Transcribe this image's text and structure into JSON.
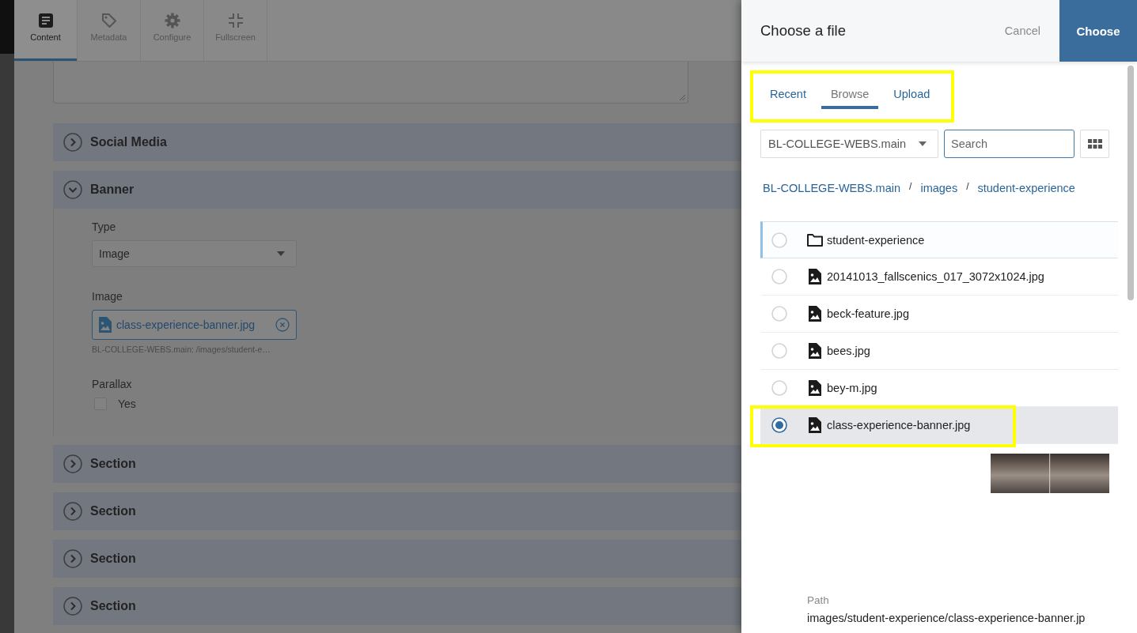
{
  "toolbar": {
    "tabs": [
      {
        "label": "Content",
        "selected": true
      },
      {
        "label": "Metadata",
        "selected": false
      },
      {
        "label": "Configure",
        "selected": false
      },
      {
        "label": "Fullscreen",
        "selected": false
      }
    ]
  },
  "sections": [
    {
      "title": "Social Media",
      "expanded": false
    },
    {
      "title": "Banner",
      "expanded": true,
      "fields": [
        {
          "kind": "select",
          "label": "Type",
          "value": "Image"
        },
        {
          "kind": "file",
          "label": "Image",
          "value": "class-experience-banner.jpg",
          "hint": "BL-COLLEGE-WEBS.main: /images/student-e…"
        },
        {
          "kind": "checkbox",
          "label": "Parallax",
          "option": "Yes",
          "checked": false
        }
      ]
    },
    {
      "title": "Section",
      "expanded": false
    },
    {
      "title": "Section",
      "expanded": false
    },
    {
      "title": "Section",
      "expanded": false
    },
    {
      "title": "Section",
      "expanded": false
    }
  ],
  "file_chooser": {
    "title": "Choose a file",
    "cancel": "Cancel",
    "choose": "Choose",
    "tabs": {
      "highlighted": true,
      "items": [
        {
          "label": "Recent",
          "selected": false
        },
        {
          "label": "Browse",
          "selected": true
        },
        {
          "label": "Upload",
          "selected": false
        }
      ]
    },
    "site_select": {
      "value": "BL-COLLEGE-WEBS.main"
    },
    "search": {
      "placeholder": "Search"
    },
    "breadcrumb": {
      "separator": "/",
      "items": [
        "BL-COLLEGE-WEBS.main",
        "images",
        "student-experience"
      ]
    },
    "items": [
      {
        "kind": "folder",
        "name": "student-experience",
        "selected": false,
        "focused": true,
        "highlighted": false
      },
      {
        "kind": "image",
        "name": "20141013_fallscenics_017_3072x1024.jpg",
        "selected": false,
        "focused": false,
        "highlighted": false
      },
      {
        "kind": "image",
        "name": "beck-feature.jpg",
        "selected": false,
        "focused": false,
        "highlighted": false
      },
      {
        "kind": "image",
        "name": "bees.jpg",
        "selected": false,
        "focused": false,
        "highlighted": false
      },
      {
        "kind": "image",
        "name": "bey-m.jpg",
        "selected": false,
        "focused": false,
        "highlighted": false
      },
      {
        "kind": "image",
        "name": "class-experience-banner.jpg",
        "selected": true,
        "focused": false,
        "highlighted": true
      }
    ],
    "details": {
      "path_label": "Path",
      "path": "images/student-experience/class-experience-banner.jp"
    }
  }
}
